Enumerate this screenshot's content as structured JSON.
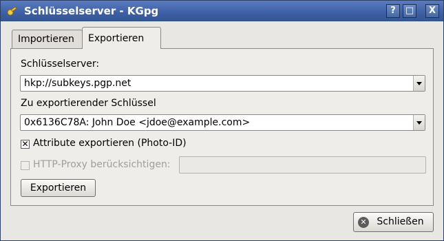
{
  "window": {
    "title": "Schlüsselserver - KGpg",
    "buttons": {
      "help": "?",
      "maximize": "□",
      "close": "X"
    }
  },
  "tabs": [
    {
      "label": "Importieren",
      "active": false
    },
    {
      "label": "Exportieren",
      "active": true
    }
  ],
  "export": {
    "server_label": "Schlüsselserver:",
    "server_value": "hkp://subkeys.pgp.net",
    "key_label": "Zu exportierender Schlüssel",
    "key_value": "0x6136C78A: John Doe <jdoe@example.com>",
    "attr_checkbox_label": "Attribute exportieren (Photo-ID)",
    "attr_checked": true,
    "proxy_checkbox_label": "HTTP-Proxy berücksichtigen:",
    "proxy_checked": false,
    "proxy_value": "",
    "export_button": "Exportieren"
  },
  "footer": {
    "close_button": "Schließen"
  },
  "icons": {
    "app": "kgpg-key-icon",
    "close": "close-circle-icon"
  }
}
